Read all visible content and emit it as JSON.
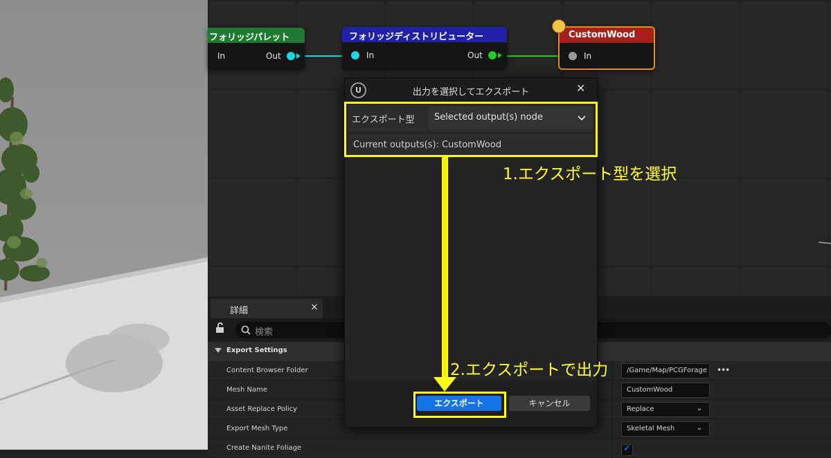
{
  "graph": {
    "nodes": [
      {
        "title": "フォリッジパレット",
        "in_label": "In",
        "out_label": "Out",
        "header_color": "#1e7a2e"
      },
      {
        "title": "フォリッジディストリビューター",
        "in_label": "In",
        "out_label": "Out",
        "header_color": "#2121a8"
      },
      {
        "title": "CustomWood",
        "in_label": "In",
        "header_color": "#a51f1f",
        "selected_outline": "#e8900e"
      }
    ],
    "wire_colors": {
      "cyan": "#1ed6e0",
      "green": "#22cc22",
      "gray": "#8c8c8c"
    }
  },
  "details": {
    "tab_title": "詳細",
    "tab_close": "×",
    "search_placeholder": "検索",
    "section": "Export Settings",
    "rows": [
      {
        "label": "Content Browser Folder",
        "value": "/Game/Map/PCGForage",
        "more": "•••"
      },
      {
        "label": "Mesh Name",
        "value": "CustomWood"
      },
      {
        "label": "Asset Replace Policy",
        "value": "Replace",
        "chevron": "⌄"
      },
      {
        "label": "Export Mesh Type",
        "value": "Skeletal Mesh",
        "chevron": "⌄"
      },
      {
        "label": "Create Nanite Foliage",
        "checked": true,
        "check_mark": "✓"
      }
    ]
  },
  "dialog": {
    "title": "出力を選択してエクスポート",
    "logo": "U",
    "close": "✕",
    "export_type_label": "エクスポート型",
    "export_type_value": "Selected output(s) node",
    "current_outputs": "Current outputs(s): CustomWood",
    "export_button": "エクスポート",
    "cancel_button": "キャンセル"
  },
  "annotations": {
    "step1": "1.エクスポート型を選択",
    "step2": "2.エクスポートで出力",
    "color": "#ffff1a"
  }
}
